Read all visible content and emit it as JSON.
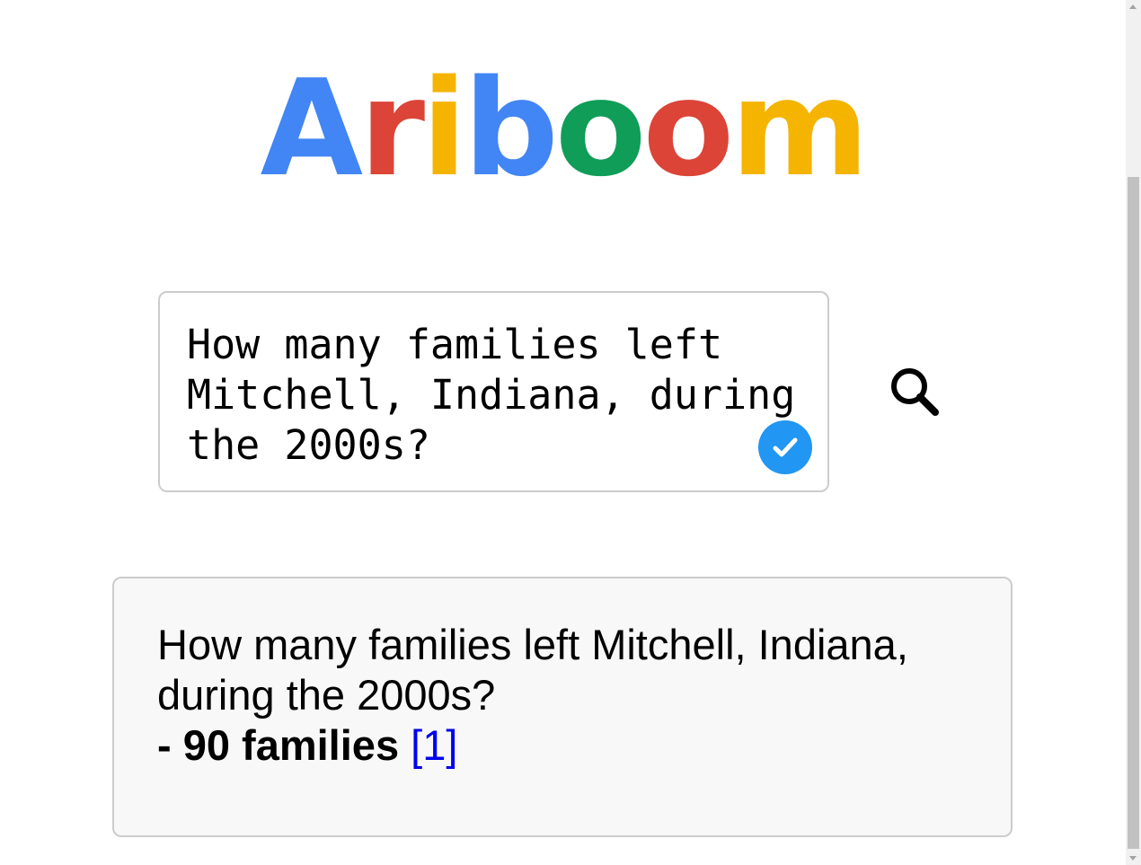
{
  "logo": {
    "letters": [
      {
        "char": "A",
        "color": "#4285f4"
      },
      {
        "char": "r",
        "color": "#db4437"
      },
      {
        "char": "i",
        "color": "#f4b400"
      },
      {
        "char": "b",
        "color": "#4285f4"
      },
      {
        "char": "o",
        "color": "#0f9d58"
      },
      {
        "char": "o",
        "color": "#db4437"
      },
      {
        "char": "m",
        "color": "#f4b400"
      }
    ]
  },
  "search": {
    "query": "How many families left Mitchell, Indiana, during the 2000s?",
    "check_icon": "check-circle-icon",
    "check_color": "#2196f3",
    "search_icon": "magnifier-icon"
  },
  "answer": {
    "question": "How many families left Mitchell, Indiana, during the 2000s?",
    "result": "- 90 families",
    "citation": "[1]",
    "citation_color": "#0000ee"
  }
}
